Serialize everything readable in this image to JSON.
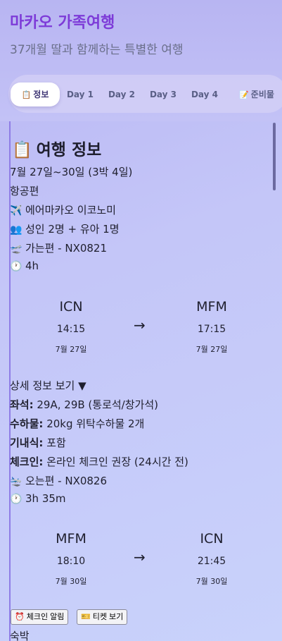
{
  "app": {
    "title": "마카오 가족여행",
    "subtitle": "37개월 딸과 함께하는 특별한 여행"
  },
  "tabs": [
    {
      "label": "정보",
      "icon": "clipboard-icon",
      "active": true
    },
    {
      "label": "Day 1"
    },
    {
      "label": "Day 2"
    },
    {
      "label": "Day 3"
    },
    {
      "label": "Day 4"
    },
    {
      "label": "준비물",
      "icon": "pencil-icon"
    }
  ],
  "info": {
    "title": "여행 정보",
    "dates": "7월 27일~30일 (3박 4일)",
    "flight_section": "항공편",
    "airline": "에어마카오 이코노미",
    "passengers": "성인 2명 + 유아 1명",
    "outbound": {
      "label": "가는편 - NX0821",
      "duration": "4h",
      "from_code": "ICN",
      "from_time": "14:15",
      "from_date": "7월 27일",
      "to_code": "MFM",
      "to_time": "17:15",
      "to_date": "7월 27일",
      "arrow": "→"
    },
    "details_toggle": "상세 정보 보기 ▼",
    "details": {
      "seat_label": "좌석:",
      "seat_value": "29A, 29B (통로석/창가석)",
      "baggage_label": "수하물:",
      "baggage_value": "20kg 위탁수하물 2개",
      "meal_label": "기내식:",
      "meal_value": "포함",
      "checkin_label": "체크인:",
      "checkin_value": "온라인 체크인 권장 (24시간 전)"
    },
    "inbound": {
      "label": "오는편 - NX0826",
      "duration": "3h 35m",
      "from_code": "MFM",
      "from_time": "18:10",
      "from_date": "7월 30일",
      "to_code": "ICN",
      "to_time": "21:45",
      "to_date": "7월 30일",
      "arrow": "→"
    },
    "buttons": {
      "checkin_alert": "체크인 알림",
      "ticket_view": "티켓 보기"
    },
    "accommodation": "숙박"
  },
  "colors": {
    "title": "#7d3bd8",
    "accent_line": "#8f7de6"
  }
}
